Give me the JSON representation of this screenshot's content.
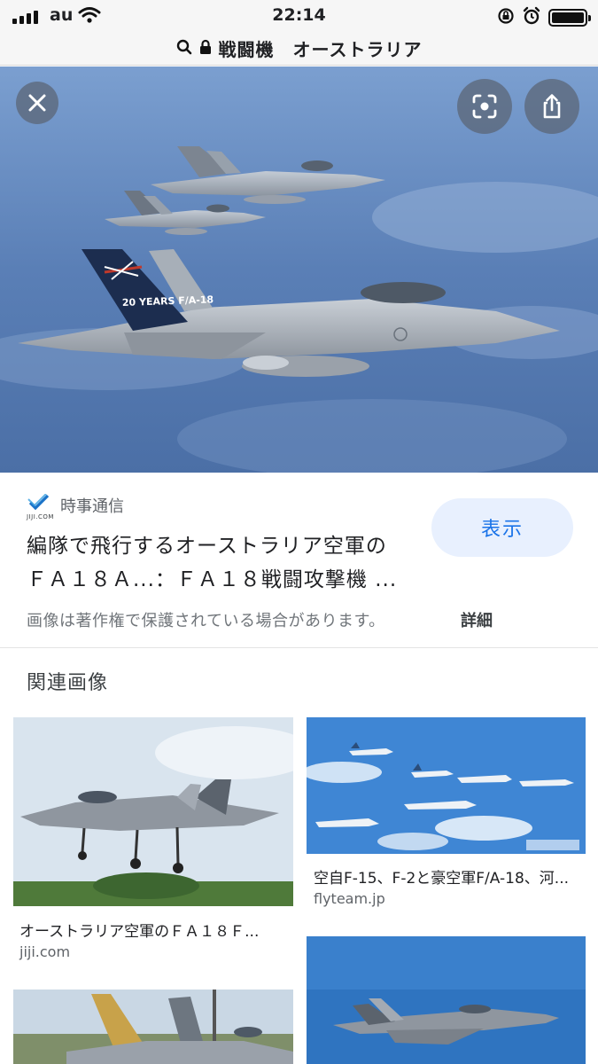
{
  "status_bar": {
    "carrier": "au",
    "time": "22:14"
  },
  "url_bar": {
    "text": "戦闘機　オーストラリア",
    "search_icon": "search-icon",
    "lock_icon": "lock-icon"
  },
  "hero": {
    "tail_badge_text": "20 YEARS F/A-18",
    "close_icon": "close-icon",
    "lens_icon": "lens-icon",
    "share_icon": "share-icon"
  },
  "result": {
    "source_name": "時事通信",
    "source_logo_text": "JIJI.COM",
    "title_line1": "編隊で飛行するオーストラリア空軍の",
    "title_line2": "ＦＡ１８Ａ...：ＦＡ１８戦闘攻撃機 ...",
    "view_button": "表示",
    "copyright_notice": "画像は著作権で保護されている場合があります。",
    "details_link": "詳細"
  },
  "related": {
    "heading": "関連画像",
    "items": [
      {
        "caption": "オーストラリア空軍のＦＡ１８Ｆ...",
        "domain": "jiji.com"
      },
      {
        "caption": "空自F-15、F-2と豪空軍F/A-18、河...",
        "domain": "flyteam.jp"
      },
      {
        "caption": "",
        "domain": ""
      },
      {
        "caption": "",
        "domain": ""
      }
    ]
  },
  "colors": {
    "accent": "#1a73e8",
    "button_bg": "#e8f0fe",
    "sky": "#5b7fb8"
  }
}
